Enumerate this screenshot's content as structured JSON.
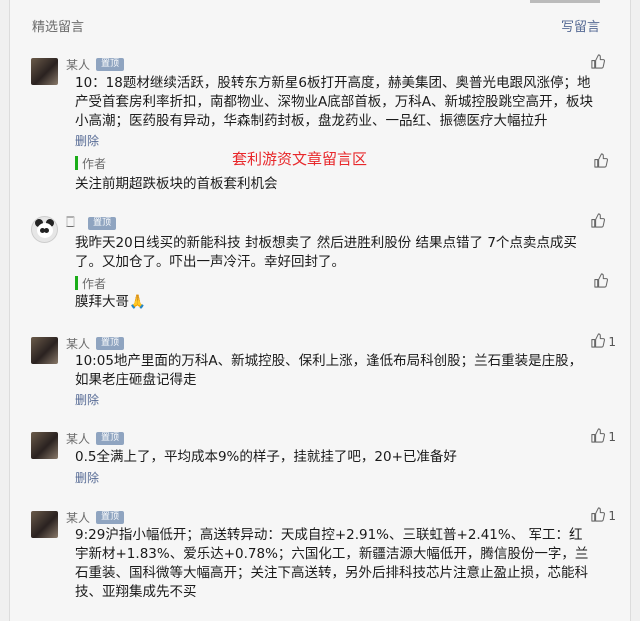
{
  "header": {
    "title": "精选留言",
    "write_label": "写留言"
  },
  "watermark": "套利游资文章留言区",
  "comments": [
    {
      "nick": "某人",
      "badge": "置顶",
      "likes": "",
      "text": "10：18题材继续活跃，股转东方新星6板打开高度，赫美集团、奥普光电跟风涨停；地产受首套房利率折扣，南都物业、深物业A底部首板，万科A、新城控股跳空高开，板块小高潮；医药股有异动，华森制药封板，盘龙药业、一品红、振德医疗大幅拉升",
      "delete": "删除",
      "author_label": "作者",
      "author_reply": "关注前期超跌板块的首板套利机会"
    },
    {
      "nick": "🀆",
      "badge": "置顶",
      "likes": "",
      "text": "我昨天20日线买的新能科技 封板想卖了 然后进胜利股份 结果点错了 7个点卖点成买了。又加仓了。吓出一声冷汗。幸好回封了。",
      "author_label": "作者",
      "author_reply": "膜拜大哥🙏"
    },
    {
      "nick": "某人",
      "badge": "置顶",
      "likes": "1",
      "text": "10:05地产里面的万科A、新城控股、保利上涨，逢低布局科创股；兰石重装是庄股，如果老庄砸盘记得走",
      "delete": "删除"
    },
    {
      "nick": "某人",
      "badge": "置顶",
      "likes": "1",
      "text": "0.5全满上了，平均成本9%的样子，挂就挂了吧，20+已准备好",
      "delete": "删除"
    },
    {
      "nick": "某人",
      "badge": "置顶",
      "likes": "1",
      "text": "9:29沪指小幅低开；高送转异动：天成自控+2.91%、三联虹普+2.41%、 军工：红宇新材+1.83%、爱乐达+0.78%；六国化工，新疆洁源大幅低开，腾信股份一字，兰石重装、国科微等大幅高开；关注下高送转，另外后排科技芯片注意止盈止损，芯能科技、亚翔集成先不买"
    }
  ]
}
